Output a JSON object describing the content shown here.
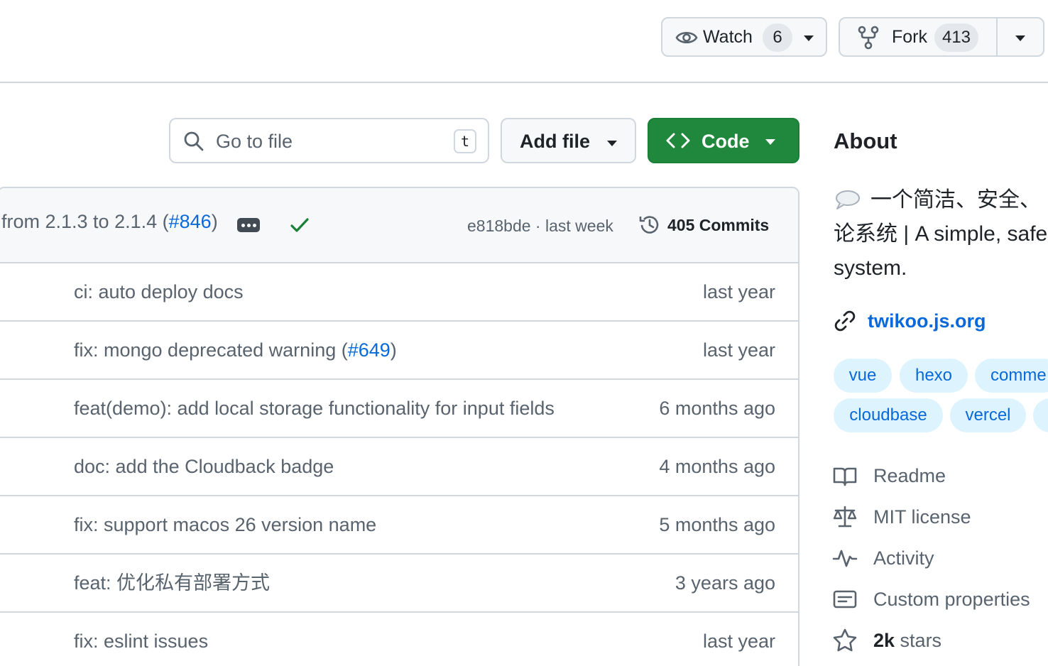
{
  "header": {
    "watch": {
      "label": "Watch",
      "count": "6"
    },
    "fork": {
      "label": "Fork",
      "count": "413"
    }
  },
  "toolbar": {
    "search_placeholder": "Go to file",
    "search_shortcut": "t",
    "add_file_label": "Add file",
    "code_label": "Code"
  },
  "latest_commit": {
    "message_prefix": "from 2.1.3 to 2.1.4 (",
    "pr_link": "#846",
    "message_suffix": ")",
    "hash_and_time": "e818bde · last week",
    "commits_label": "405 Commits"
  },
  "rows": [
    {
      "message": "ci: auto deploy docs",
      "age": "last year"
    },
    {
      "message_prefix": "fix: mongo deprecated warning (",
      "link": "#649",
      "message_suffix": ")",
      "age": "last year"
    },
    {
      "message": "feat(demo): add local storage functionality for input fields",
      "age": "6 months ago"
    },
    {
      "message": "doc: add the Cloudback badge",
      "age": "4 months ago"
    },
    {
      "message": "fix: support macos 26 version name",
      "age": "5 months ago"
    },
    {
      "message": "feat: 优化私有部署方式",
      "age": "3 years ago"
    },
    {
      "message": "fix: eslint issues",
      "age": "last year"
    }
  ],
  "about": {
    "title": "About",
    "description_line1": "一个简洁、安全、",
    "description_line2": "论系统 | A simple, safe",
    "description_line3": "system.",
    "website": "twikoo.js.org",
    "topics": [
      "vue",
      "hexo",
      "comme",
      "cloudbase",
      "vercel"
    ],
    "items": {
      "readme": "Readme",
      "license": "MIT license",
      "activity": "Activity",
      "custom_properties": "Custom properties",
      "stars_count": "2k",
      "stars_label": " stars"
    }
  },
  "colors": {
    "accent": "#0969da",
    "primary_button": "#1f883d",
    "check": "#1a7f37",
    "border": "#d0d7de",
    "muted_text": "#59636e",
    "topic_bg": "#ddf4ff"
  }
}
